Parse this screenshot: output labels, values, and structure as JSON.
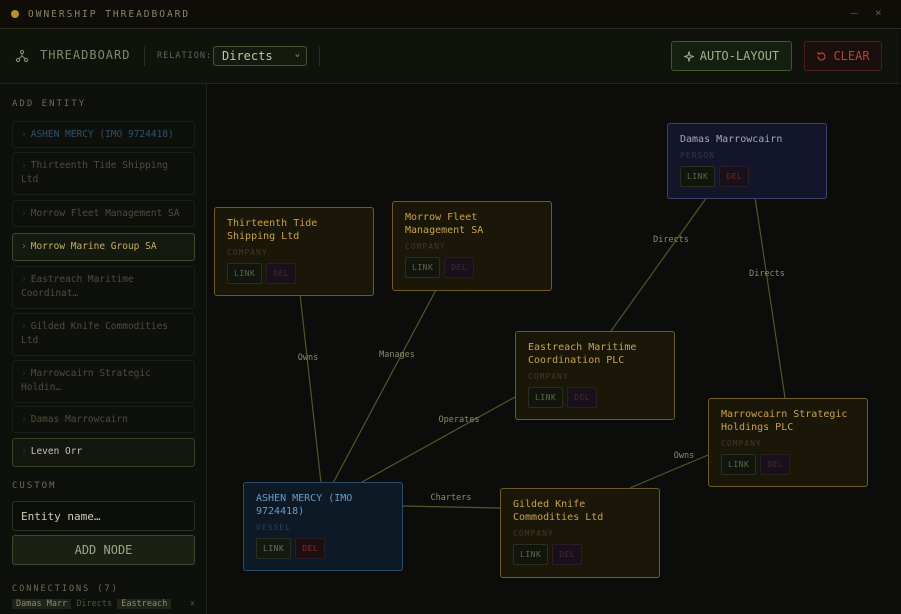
{
  "window": {
    "title": "OWNERSHIP THREADBOARD",
    "minimize": "–",
    "close": "×"
  },
  "toolbar": {
    "brand": "THREADBOARD",
    "relation_label": "RELATION:",
    "relation_value": "Directs",
    "auto_layout": "AUTO-LAYOUT",
    "clear": "CLEAR"
  },
  "sidebar": {
    "add_entity_label": "ADD ENTITY",
    "entities": [
      {
        "label": "ASHEN MERCY (IMO 9724418)",
        "kind": "vessel",
        "state": "dim"
      },
      {
        "label": "Thirteenth Tide Shipping Ltd",
        "kind": "company",
        "state": "dim"
      },
      {
        "label": "Morrow Fleet Management SA",
        "kind": "company",
        "state": "dim"
      },
      {
        "label": "Morrow Marine Group SA",
        "kind": "company",
        "state": "active"
      },
      {
        "label": "Eastreach Maritime Coordinat…",
        "kind": "company",
        "state": "dim"
      },
      {
        "label": "Gilded Knife Commodities Ltd",
        "kind": "company",
        "state": "dim"
      },
      {
        "label": "Marrowcairn Strategic Holdin…",
        "kind": "company",
        "state": "dim"
      },
      {
        "label": "Damas Marrowcairn",
        "kind": "person",
        "state": "dim"
      },
      {
        "label": "Leven Orr",
        "kind": "person",
        "state": "white"
      }
    ],
    "custom_label": "CUSTOM",
    "custom_placeholder": "Entity name…",
    "add_node": "ADD NODE",
    "connections_label": "CONNECTIONS (7)",
    "connection_row": {
      "from": "Damas Marr",
      "rel": "Directs",
      "to": "Eastreach",
      "remove": "×"
    }
  },
  "graph": {
    "nodes": [
      {
        "id": "thirteenth",
        "name": "Thirteenth Tide Shipping Ltd",
        "type": "COMPANY",
        "kind": "company"
      },
      {
        "id": "morrowfleet",
        "name": "Morrow Fleet Management SA",
        "type": "COMPANY",
        "kind": "company"
      },
      {
        "id": "damas",
        "name": "Damas Marrowcairn",
        "type": "PERSON",
        "kind": "person"
      },
      {
        "id": "eastreach",
        "name": "Eastreach Maritime Coordination PLC",
        "type": "COMPANY",
        "kind": "company"
      },
      {
        "id": "marrowcairn",
        "name": "Marrowcairn Strategic Holdings PLC",
        "type": "COMPANY",
        "kind": "company"
      },
      {
        "id": "ashen",
        "name": "ASHEN MERCY (IMO 9724418)",
        "type": "VESSEL",
        "kind": "vessel"
      },
      {
        "id": "gilded",
        "name": "Gilded Knife Commodities Ltd",
        "type": "COMPANY",
        "kind": "company"
      }
    ],
    "node_buttons": {
      "link": "LINK",
      "del": "DEL"
    },
    "edges": [
      {
        "from": "thirteenth",
        "to": "ashen",
        "label": "Owns"
      },
      {
        "from": "morrowfleet",
        "to": "ashen",
        "label": "Manages"
      },
      {
        "from": "eastreach",
        "to": "ashen",
        "label": "Operates"
      },
      {
        "from": "gilded",
        "to": "ashen",
        "label": "Charters"
      },
      {
        "from": "damas",
        "to": "eastreach",
        "label": "Directs"
      },
      {
        "from": "damas",
        "to": "marrowcairn",
        "label": "Directs"
      },
      {
        "from": "marrowcairn",
        "to": "gilded",
        "label": "Owns"
      }
    ]
  }
}
